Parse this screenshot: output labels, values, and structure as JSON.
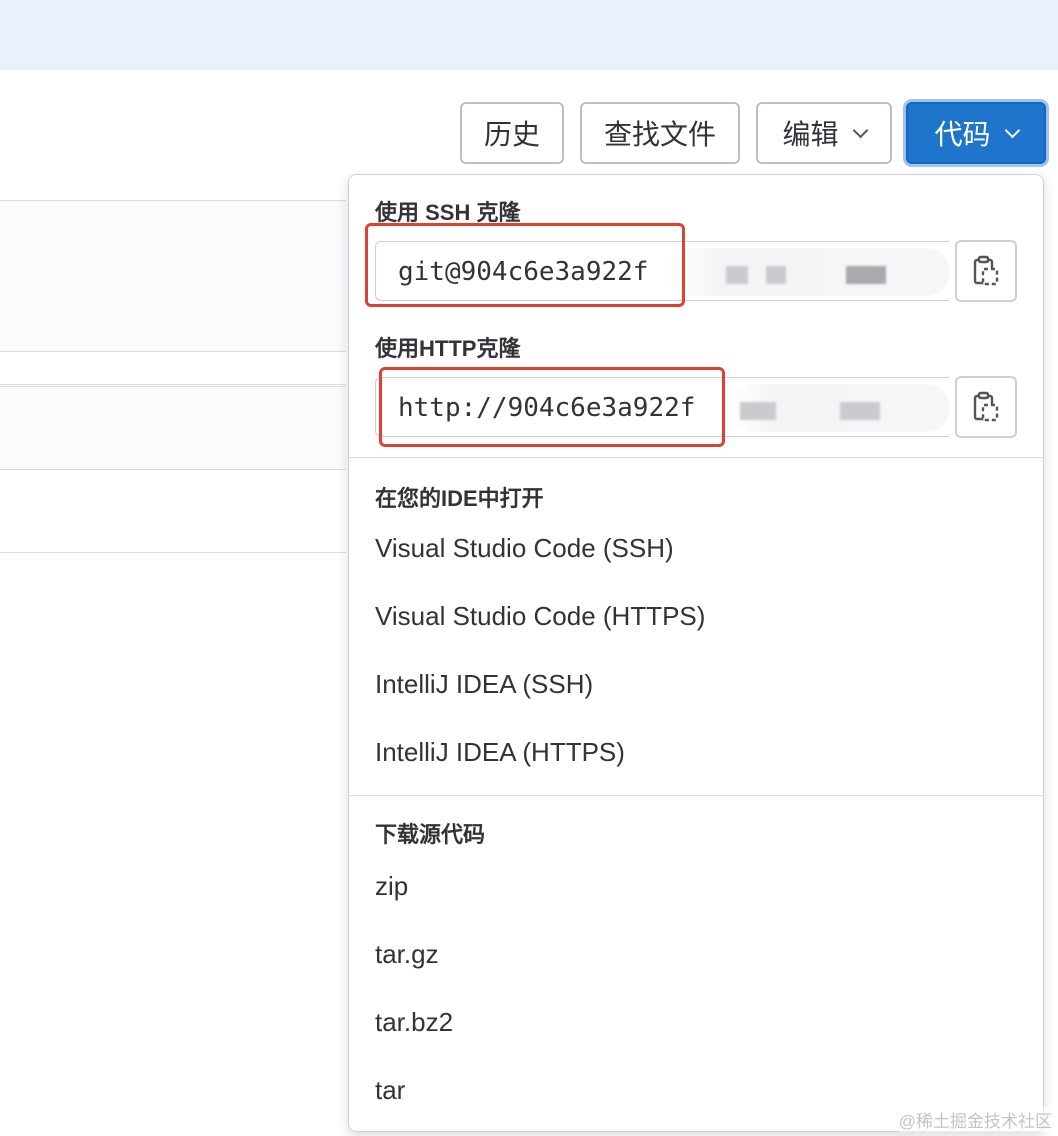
{
  "toolbar": {
    "history_label": "历史",
    "find_file_label": "查找文件",
    "edit_label": "编辑",
    "code_label": "代码"
  },
  "dropdown": {
    "ssh_title": "使用 SSH 克隆",
    "ssh_url": "git@904c6e3a922f",
    "http_title": "使用HTTP克隆",
    "http_url": "http://904c6e3a922f",
    "ide_title": "在您的IDE中打开",
    "ide_items": [
      "Visual Studio Code (SSH)",
      "Visual Studio Code (HTTPS)",
      "IntelliJ IDEA (SSH)",
      "IntelliJ IDEA (HTTPS)"
    ],
    "download_title": "下载源代码",
    "download_items": [
      "zip",
      "tar.gz",
      "tar.bz2",
      "tar"
    ]
  },
  "watermark": "@稀土掘金技术社区",
  "colors": {
    "primary": "#1f75cb",
    "highlight": "#e0402f",
    "topbar": "#eaf1fb"
  },
  "icons": {
    "copy": "clipboard-copy-icon",
    "chevron": "chevron-down-icon"
  }
}
